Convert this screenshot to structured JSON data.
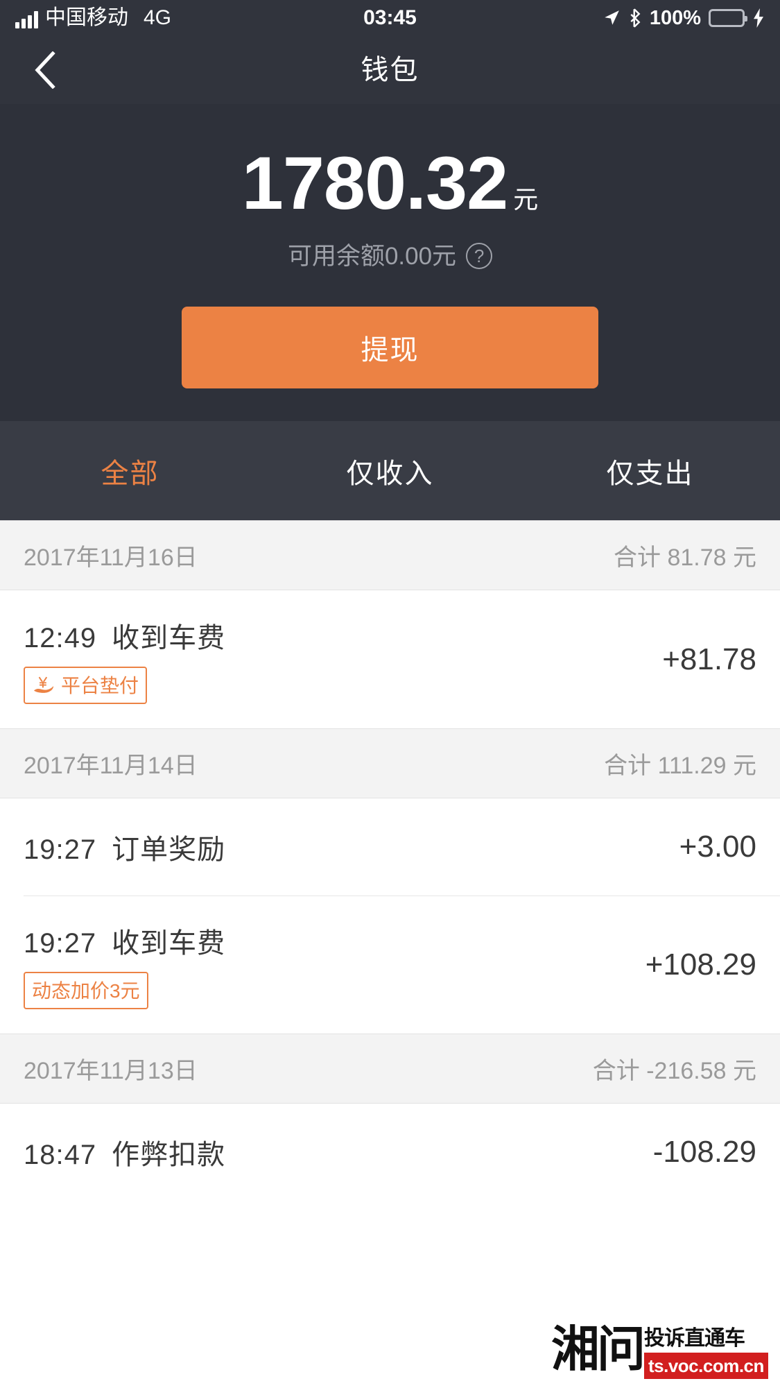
{
  "status_bar": {
    "carrier": "中国移动",
    "network": "4G",
    "time": "03:45",
    "battery_percent": "100%",
    "signal_icon": "signal-bars-icon",
    "location_icon": "location-arrow-icon",
    "bluetooth_icon": "bluetooth-icon",
    "battery_icon": "battery-icon",
    "charging_icon": "charging-bolt-icon"
  },
  "nav": {
    "title": "钱包",
    "back_icon": "back-chevron-icon"
  },
  "balance": {
    "amount": "1780.32",
    "unit": "元",
    "available_text": "可用余额0.00元",
    "help_icon": "question-mark-icon",
    "help_glyph": "?",
    "withdraw_label": "提现",
    "accent_color": "#EC8244",
    "panel_color": "#2E313A"
  },
  "tabs": [
    {
      "label": "全部",
      "active": true
    },
    {
      "label": "仅收入",
      "active": false
    },
    {
      "label": "仅支出",
      "active": false
    }
  ],
  "groups": [
    {
      "date": "2017年11月16日",
      "total": "合计 81.78 元",
      "items": [
        {
          "time": "12:49",
          "title": "收到车费",
          "amount": "+81.78",
          "badge": "平台垫付",
          "badge_icon": "hand-holding-yuan-icon"
        }
      ]
    },
    {
      "date": "2017年11月14日",
      "total": "合计 111.29 元",
      "items": [
        {
          "time": "19:27",
          "title": "订单奖励",
          "amount": "+3.00",
          "badge": "",
          "badge_icon": ""
        },
        {
          "time": "19:27",
          "title": "收到车费",
          "amount": "+108.29",
          "badge": "动态加价3元",
          "badge_icon": ""
        }
      ]
    },
    {
      "date": "2017年11月13日",
      "total": "合计 -216.58 元",
      "items": [
        {
          "time": "18:47",
          "title": "作弊扣款",
          "amount": "-108.29",
          "badge": "",
          "badge_icon": ""
        }
      ]
    }
  ],
  "watermark": {
    "logo": "湘问",
    "slogan": "投诉直通车",
    "url": "ts.voc.com.cn"
  }
}
